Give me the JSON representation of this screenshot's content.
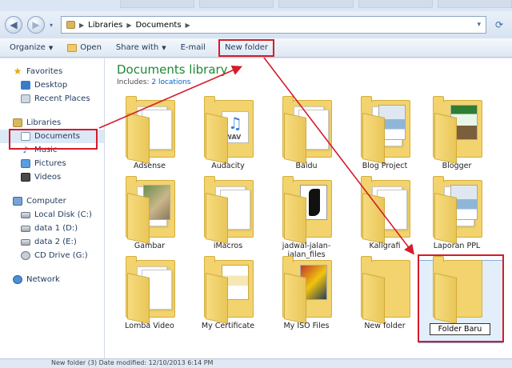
{
  "address_bar": {
    "segments": [
      "Libraries",
      "Documents"
    ]
  },
  "toolbar": {
    "organize": "Organize",
    "open": "Open",
    "share_with": "Share with",
    "email": "E-mail",
    "new_folder": "New folder"
  },
  "sidebar": {
    "favorites": {
      "label": "Favorites",
      "items": [
        "Desktop",
        "Recent Places"
      ]
    },
    "libraries": {
      "label": "Libraries",
      "items": [
        "Documents",
        "Music",
        "Pictures",
        "Videos"
      ],
      "selected": "Documents"
    },
    "computer": {
      "label": "Computer",
      "items": [
        "Local Disk (C:)",
        "data 1 (D:)",
        "data 2 (E:)",
        "CD Drive (G:)"
      ]
    },
    "network": "Network"
  },
  "library": {
    "title": "Documents library",
    "includes_label": "Includes:",
    "includes_link": "2 locations"
  },
  "folders": [
    {
      "name": "Adsense",
      "thumb": "document"
    },
    {
      "name": "Audacity",
      "thumb": "wav-icon"
    },
    {
      "name": "Baidu",
      "thumb": "document"
    },
    {
      "name": "Blog Project",
      "thumb": "document-image"
    },
    {
      "name": "Blogger",
      "thumb": "green-photo"
    },
    {
      "name": "Gambar",
      "thumb": "photo"
    },
    {
      "name": "iMacros",
      "thumb": "document"
    },
    {
      "name": "jadwal-jalan-jalan_files",
      "thumb": "calligraphy"
    },
    {
      "name": "Kaligrafi",
      "thumb": "document"
    },
    {
      "name": "Laporan PPL",
      "thumb": "document-image"
    },
    {
      "name": "Lomba Video",
      "thumb": "document"
    },
    {
      "name": "My Certificate",
      "thumb": "certificate"
    },
    {
      "name": "My ISO Files",
      "thumb": "people-photo"
    },
    {
      "name": "New folder",
      "thumb": "empty"
    },
    {
      "name": "Folder Baru",
      "thumb": "empty"
    }
  ],
  "rename_value": "Folder Baru",
  "status": "New folder (3)   Date modified: 12/10/2013 6:14 PM",
  "colors": {
    "highlight": "#d41c2a",
    "title_green": "#1b8a33",
    "link_blue": "#0066cc"
  }
}
